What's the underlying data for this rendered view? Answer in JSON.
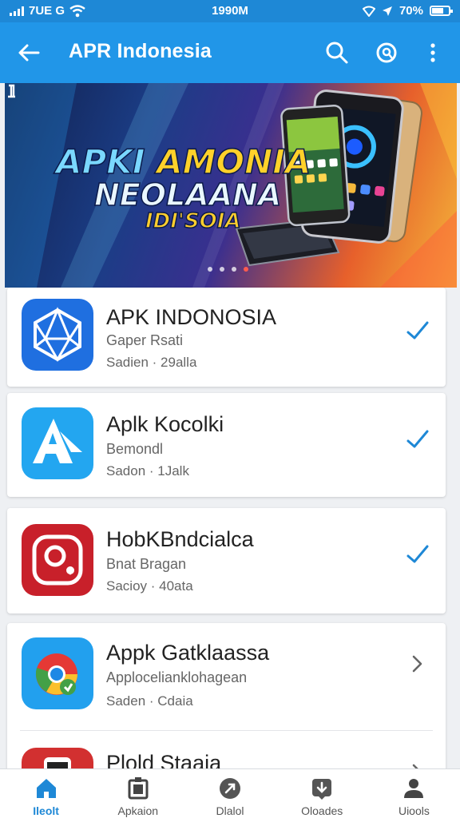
{
  "status_bar": {
    "carrier": "7UE G",
    "time": "1990M",
    "battery": "70%",
    "battery_level": 0.7
  },
  "app_bar": {
    "title": "APR Indonesia",
    "back_icon": "back-arrow-icon",
    "search_icon": "search-icon",
    "lens_icon": "lens-icon",
    "menu_icon": "more-vert-icon"
  },
  "banner": {
    "line1_a": "APKI ",
    "line1_b": "AMONIA",
    "line2": "NEOLAANA",
    "line3": "IDI'SOIA",
    "dots": 4,
    "active_dot": 3
  },
  "apps": [
    {
      "name": "APK INDONOSIA",
      "sub": "Gaper Rsati",
      "meta": "Sadien · 29alla",
      "action": "check"
    },
    {
      "name": "Aplk Kocolki",
      "sub": "Bemondl",
      "meta": "Sadon · 1Jalk",
      "action": "check"
    },
    {
      "name": "HobKBndcialca",
      "sub": "Bnat Bragan",
      "meta": "Sacioy · 40ata",
      "action": "check"
    },
    {
      "name": "Appk Gatklaassa",
      "sub": "Applocelianklohagean",
      "meta": "Saden · Cdaia",
      "action": "chevron"
    },
    {
      "name": "Plold Staaia",
      "sub": "",
      "meta": "",
      "action": "chevron"
    }
  ],
  "nav": [
    {
      "label": "Ileolt",
      "icon": "home-icon",
      "active": true
    },
    {
      "label": "Apkaion",
      "icon": "apps-icon",
      "active": false
    },
    {
      "label": "Dlalol",
      "icon": "update-icon",
      "active": false
    },
    {
      "label": "Oloades",
      "icon": "download-icon",
      "active": false
    },
    {
      "label": "Uiools",
      "icon": "profile-icon",
      "active": false
    }
  ],
  "colors": {
    "primary": "#2196e8",
    "status": "#1e88d6",
    "accent_check": "#1e88d6"
  }
}
